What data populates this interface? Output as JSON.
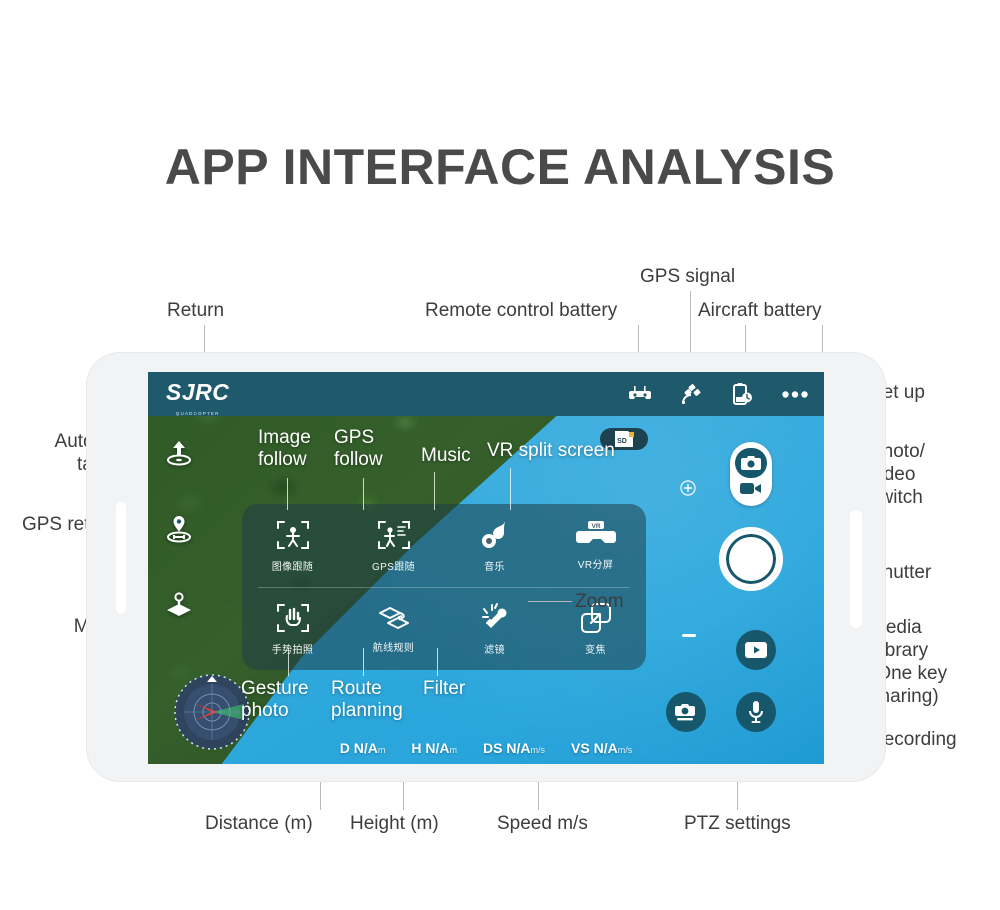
{
  "title": "APP INTERFACE ANALYSIS",
  "callouts": {
    "return": "Return",
    "remote_control_battery": "Remote control battery",
    "gps_signal": "GPS signal",
    "aircraft_battery": "Aircraft battery",
    "set_up": "Set up",
    "photo_video_switch": "Photo/\nvideo\nswitch",
    "shutter": "Shutter",
    "media_library": "Media\nLibrary\n(One key\nsharing)",
    "recording": "Recording",
    "automatic_take_off": "Automatic\ntake off",
    "gps_return": "GPS return",
    "more": "More",
    "distance": "Distance (m)",
    "height": "Height (m)",
    "speed": "Speed m/s",
    "ptz_settings": "PTZ settings"
  },
  "overlay_callouts": {
    "image_follow": "Image\nfollow",
    "gps_follow": "GPS\nfollow",
    "music": "Music",
    "vr_split_screen": "VR split screen",
    "zoom": "Zoom",
    "gesture_photo": "Gesture\nphoto",
    "route_planning": "Route\nplanning",
    "filter": "Filter"
  },
  "app": {
    "brand": "SJRC",
    "brand_sub": "QUADCOPTER",
    "status_icons": [
      {
        "name": "remote-controller-icon"
      },
      {
        "name": "satellite-icon"
      },
      {
        "name": "battery-clock-icon"
      },
      {
        "name": "more-options-icon"
      }
    ],
    "left_controls": [
      {
        "name": "auto-takeoff-icon"
      },
      {
        "name": "gps-return-icon"
      },
      {
        "name": "more-joystick-icon"
      }
    ],
    "sd_badge": "SD",
    "functions": [
      {
        "cn": "图像跟随",
        "en": "Image follow",
        "icon": "image-follow-icon"
      },
      {
        "cn": "GPS跟随",
        "en": "GPS follow",
        "icon": "gps-follow-icon"
      },
      {
        "cn": "音乐",
        "en": "Music",
        "icon": "music-icon"
      },
      {
        "cn": "VR分屏",
        "en": "VR split screen",
        "icon": "vr-split-icon"
      },
      {
        "cn": "手势拍照",
        "en": "Gesture photo",
        "icon": "gesture-photo-icon"
      },
      {
        "cn": "航线规则",
        "en": "Route planning",
        "icon": "route-planning-icon"
      },
      {
        "cn": "滤镜",
        "en": "Filter",
        "icon": "filter-icon"
      },
      {
        "cn": "变焦",
        "en": "Zoom",
        "icon": "zoom-icon"
      }
    ],
    "telemetry": [
      {
        "label": "D",
        "value": "N/A",
        "unit": "m"
      },
      {
        "label": "H",
        "value": "N/A",
        "unit": "m"
      },
      {
        "label": "DS",
        "value": "N/A",
        "unit": "m/s"
      },
      {
        "label": "VS",
        "value": "N/A",
        "unit": "m/s"
      }
    ],
    "right_controls": [
      {
        "name": "photo-video-switch"
      },
      {
        "name": "shutter-button"
      },
      {
        "name": "media-library-button"
      },
      {
        "name": "recording-button"
      },
      {
        "name": "ptz-settings-button"
      }
    ]
  },
  "colors": {
    "title": "#4a4a4a",
    "statusbar": "#1e5a6b",
    "button": "#17576b",
    "frame": "#f2f3f4",
    "leader": "#b9b9b9"
  }
}
